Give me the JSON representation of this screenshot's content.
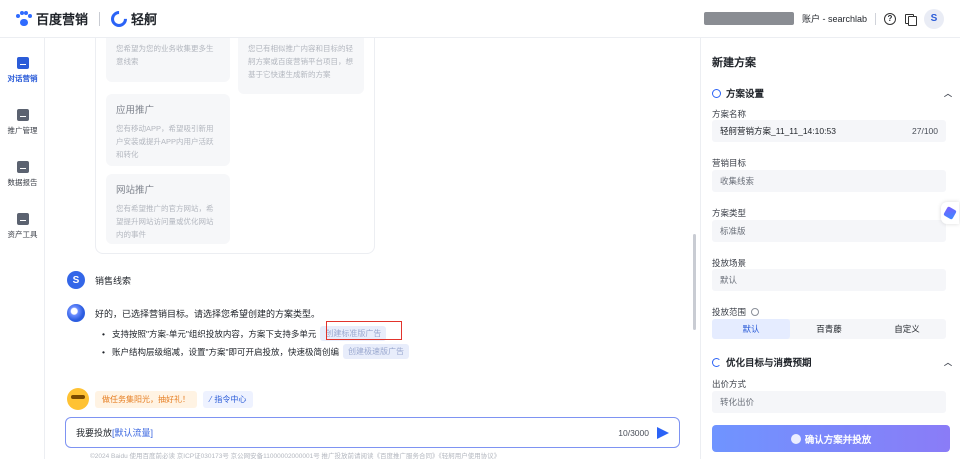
{
  "header": {
    "brand_main": "百度营销",
    "brand_sub": "轻舸",
    "account_label": "账户 - searchlab",
    "help_icon": "?",
    "avatar_letter": "S"
  },
  "nav": {
    "items": [
      {
        "label": "对话营销",
        "icon": "chat-icon"
      },
      {
        "label": "推广管理",
        "icon": "promotion-icon"
      },
      {
        "label": "数据报告",
        "icon": "report-icon"
      },
      {
        "label": "资产工具",
        "icon": "tools-icon"
      }
    ]
  },
  "chat": {
    "cards": [
      {
        "desc": "您希望为您的业务收集更多生意线索"
      },
      {
        "desc": "您已有相似推广内容和目标的轻舸方案或百度营销平台项目，想基于它快速生成新的方案"
      },
      {
        "title": "应用推广",
        "desc": "您有移动APP，希望吸引新用户安装或提升APP内用户活跃和转化"
      },
      {
        "title": "网站推广",
        "desc": "您有希望推广的官方网站，希望提升网站访问量或优化网站内的事件"
      }
    ],
    "user_msg": "销售线索",
    "user_badge": "S",
    "ai_msg": "好的，已选择营销目标。请选择您希望创建的方案类型。",
    "bullet1_text": "支持按照\"方案-单元\"组织投放内容，方案下支持多单元",
    "bullet1_chip": "创建标准版广告",
    "bullet2_text": "账户结构层级缩减，设置\"方案\"即可开启投放，快速极简创编",
    "bullet2_chip": "创建极速版广告",
    "task_chip": "做任务集阳光，抽好礼！",
    "cmd_chip": "指令中心",
    "input_prefix": "我要投放",
    "input_var": "[默认流量]",
    "input_count": "10/3000",
    "footer": "©2024 Baidu 使用百度前必读 京ICP证030173号 京公网安备11000002000001号 推广投放前请阅读《百度推广服务合同》《轻舸用户使用协议》"
  },
  "panel": {
    "title": "新建方案",
    "section1": "方案设置",
    "name_label": "方案名称",
    "name_value": "轻舸营销方案_11_11_14:10:53",
    "name_count": "27/100",
    "goal_label": "营销目标",
    "goal_value": "收集线索",
    "type_label": "方案类型",
    "type_value": "标准版",
    "scene_label": "投放场景",
    "scene_value": "默认",
    "range_label": "投放范围",
    "range_options": [
      "默认",
      "百青藤",
      "自定义"
    ],
    "section2": "优化目标与消费预期",
    "bid_label": "出价方式",
    "bid_value": "转化出价",
    "confirm": "确认方案并投放"
  }
}
